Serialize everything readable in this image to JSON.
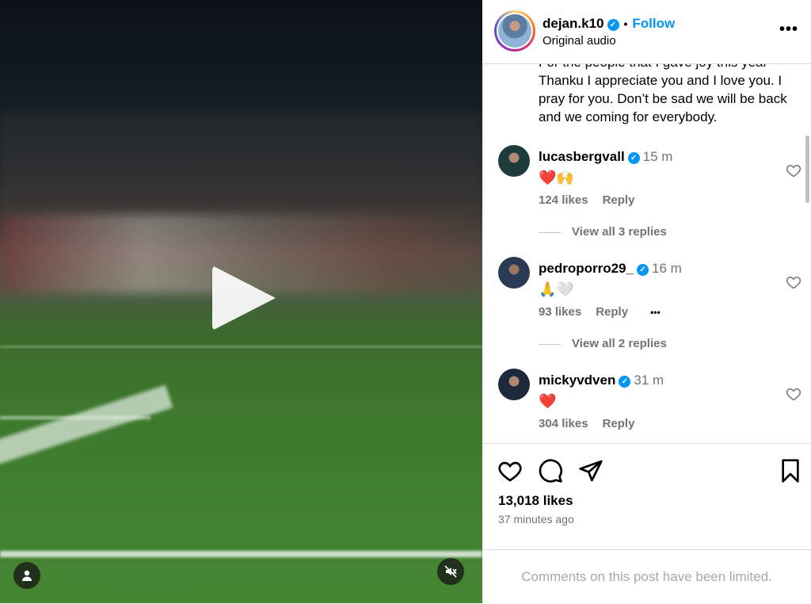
{
  "post": {
    "username": "dejan.k10",
    "follow_label": "Follow",
    "audio": "Original audio",
    "caption": "For the people that I gave joy this year Thanku I appreciate you and I love you. I pray for you. Don’t be sad we will be back and we coming for everybody.",
    "likes": "13,018 likes",
    "time_ago": "37 minutes ago",
    "limited_notice": "Comments on this post have been limited."
  },
  "comments": [
    {
      "user": "lucasbergvall",
      "time": "15 m",
      "text": "❤️🙌",
      "likes": "124 likes",
      "reply": "Reply",
      "view_replies": "View all 3 replies"
    },
    {
      "user": "pedroporro29_",
      "time": "16 m",
      "text": "🙏🤍",
      "likes": "93 likes",
      "reply": "Reply",
      "more": "•••",
      "view_replies": "View all 2 replies"
    },
    {
      "user": "mickyvdven",
      "time": "31 m",
      "text": "❤️",
      "likes": "304 likes",
      "reply": "Reply"
    }
  ],
  "icons": {
    "verified": "verified-badge-icon",
    "more": "more-options-icon",
    "play": "play-icon",
    "user": "user-tag-icon",
    "mute": "muted-speaker-icon",
    "like": "heart-icon",
    "comment": "comment-bubble-icon",
    "share": "paper-plane-icon",
    "save": "bookmark-icon"
  },
  "colors": {
    "accent": "#0095f6",
    "muted_text": "#737373"
  }
}
